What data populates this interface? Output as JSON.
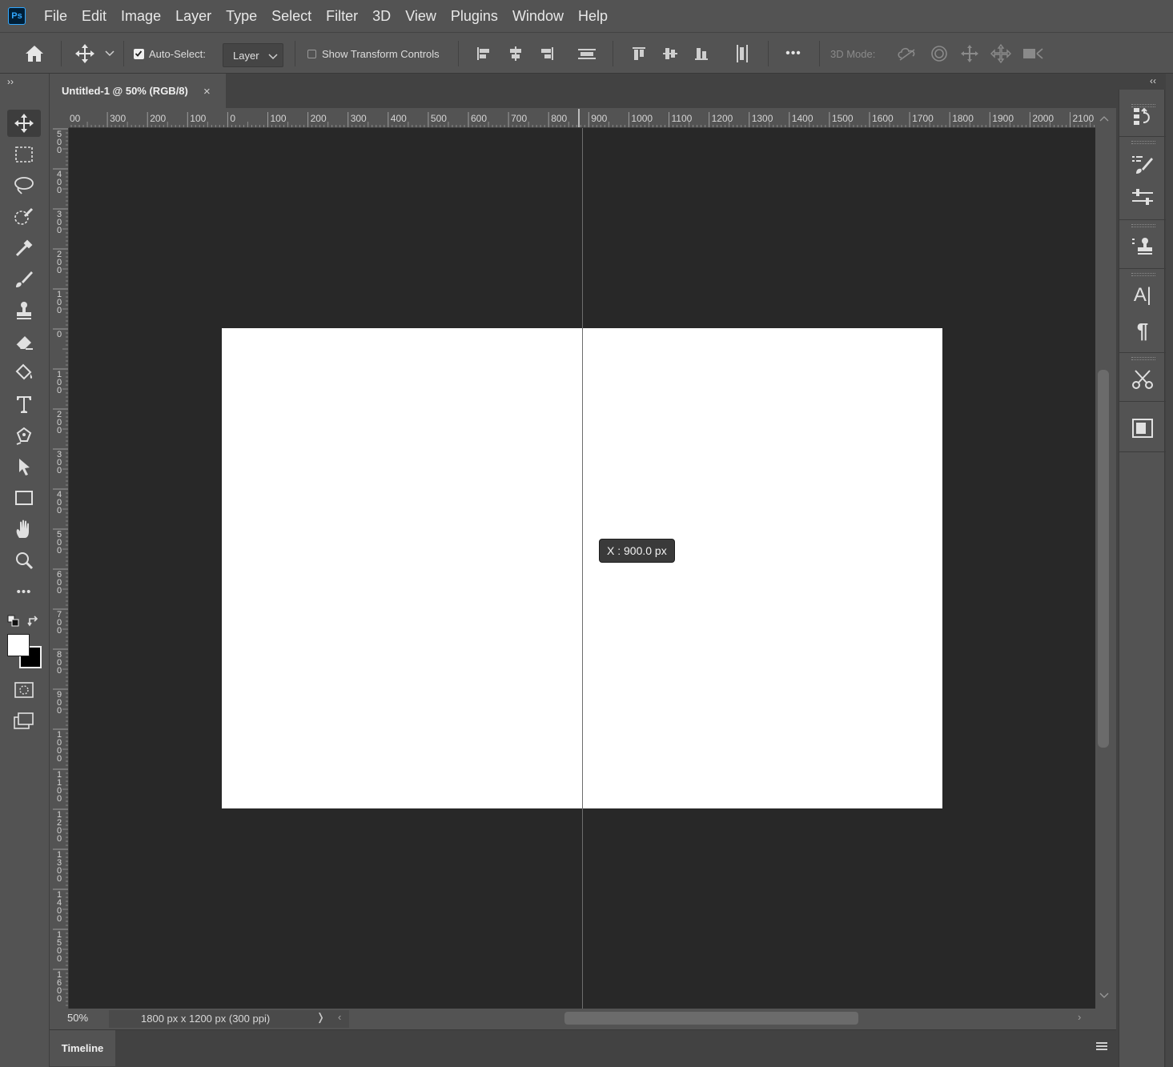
{
  "app": {
    "logo": "Ps"
  },
  "menu": [
    "File",
    "Edit",
    "Image",
    "Layer",
    "Type",
    "Select",
    "Filter",
    "3D",
    "View",
    "Plugins",
    "Window",
    "Help"
  ],
  "options": {
    "auto_select_label": "Auto-Select:",
    "auto_select_checked": true,
    "layer_select_value": "Layer",
    "transform_label": "Show Transform Controls",
    "transform_checked": false,
    "more_label": "•••",
    "mode_label": "3D Mode:"
  },
  "document": {
    "tab_title": "Untitled-1 @ 50% (RGB/8)",
    "close_glyph": "×",
    "zoom": "50%",
    "info": "1800 px x 1200 px (300 ppi)",
    "status_more": "❭",
    "scroll_left": "‹",
    "scroll_right": "›"
  },
  "ruler_top_labels": [
    "00",
    "300",
    "200",
    "100",
    "0",
    "100",
    "200",
    "300",
    "400",
    "500",
    "600",
    "700",
    "800",
    "900",
    "1000",
    "1100",
    "1200",
    "1300",
    "1400",
    "1500",
    "1600",
    "1700",
    "1800",
    "1900",
    "2000",
    "2100"
  ],
  "ruler_left_labels": [
    "500",
    "400",
    "300",
    "200",
    "100",
    "0",
    "100",
    "200",
    "300",
    "400",
    "500",
    "600",
    "700",
    "800",
    "900",
    "1000",
    "1100",
    "1200",
    "1300",
    "1400",
    "1500",
    "1600"
  ],
  "guide_tooltip": "X :  900.0 px",
  "timeline": {
    "tab_label": "Timeline"
  },
  "toolbar": {
    "collapse_glyph": "››",
    "more_tools_glyph": "•••",
    "foreground_color": "#ffffff",
    "background_color": "#000000"
  },
  "right_dock": {
    "collapse_glyph": "‹‹",
    "type_glyph": "A|",
    "paragraph_glyph": "¶"
  }
}
